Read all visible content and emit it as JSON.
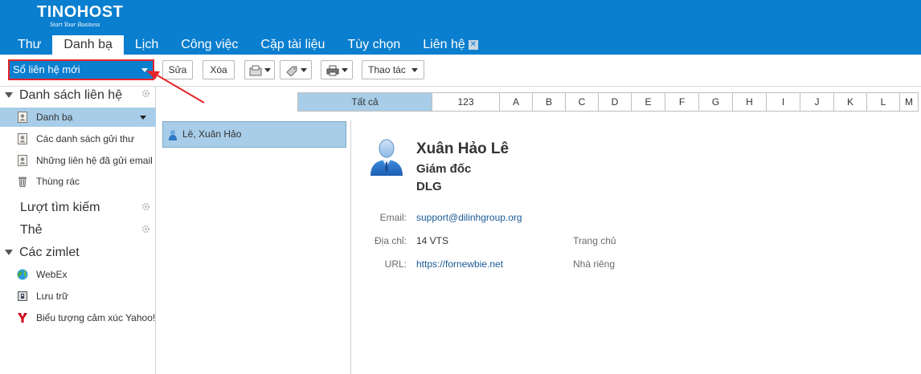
{
  "app": {
    "logo": "TINOHOST",
    "logo_tagline": "Start Your Business"
  },
  "tabs": [
    {
      "label": "Thư"
    },
    {
      "label": "Danh bạ"
    },
    {
      "label": "Lịch"
    },
    {
      "label": "Công việc"
    },
    {
      "label": "Cặp tài liệu"
    },
    {
      "label": "Tùy chọn"
    },
    {
      "label": "Liên hệ"
    }
  ],
  "toolbar": {
    "new_contact": "Sổ liên hệ mới",
    "edit": "Sửa",
    "delete": "Xóa",
    "actions": "Thao tác"
  },
  "sidebar": {
    "contacts_header": "Danh sách liên hệ",
    "items": [
      {
        "label": "Danh bạ"
      },
      {
        "label": "Các danh sách gửi thư"
      },
      {
        "label": "Những liên hệ đã gửi email"
      },
      {
        "label": "Thùng rác"
      }
    ],
    "searches_header": "Lượt tìm kiếm",
    "tags_header": "Thẻ",
    "zimlets_header": "Các zimlet",
    "zimlets": [
      {
        "label": "WebEx"
      },
      {
        "label": "Lưu trữ"
      },
      {
        "label": "Biểu tượng cảm xúc Yahoo!"
      }
    ]
  },
  "alphabet": [
    "Tất cả",
    "123",
    "A",
    "B",
    "C",
    "D",
    "E",
    "F",
    "G",
    "H",
    "I",
    "J",
    "K",
    "L",
    "M"
  ],
  "contact_list": [
    {
      "label": "Lê, Xuân Hảo"
    }
  ],
  "detail": {
    "name": "Xuân Hảo Lê",
    "job_title": "Giám đốc",
    "company": "DLG",
    "email_label": "Email:",
    "email": "support@dilinhgroup.org",
    "address_label": "Địa chỉ:",
    "address": "14 VTS",
    "address_type": "Trang chủ",
    "url_label": "URL:",
    "url": "https://fornewbie.net",
    "url_type": "Nhà riêng"
  },
  "colors": {
    "header": "#0a7ecf",
    "selection": "#a8cde8",
    "highlight_border": "#e5252a"
  }
}
